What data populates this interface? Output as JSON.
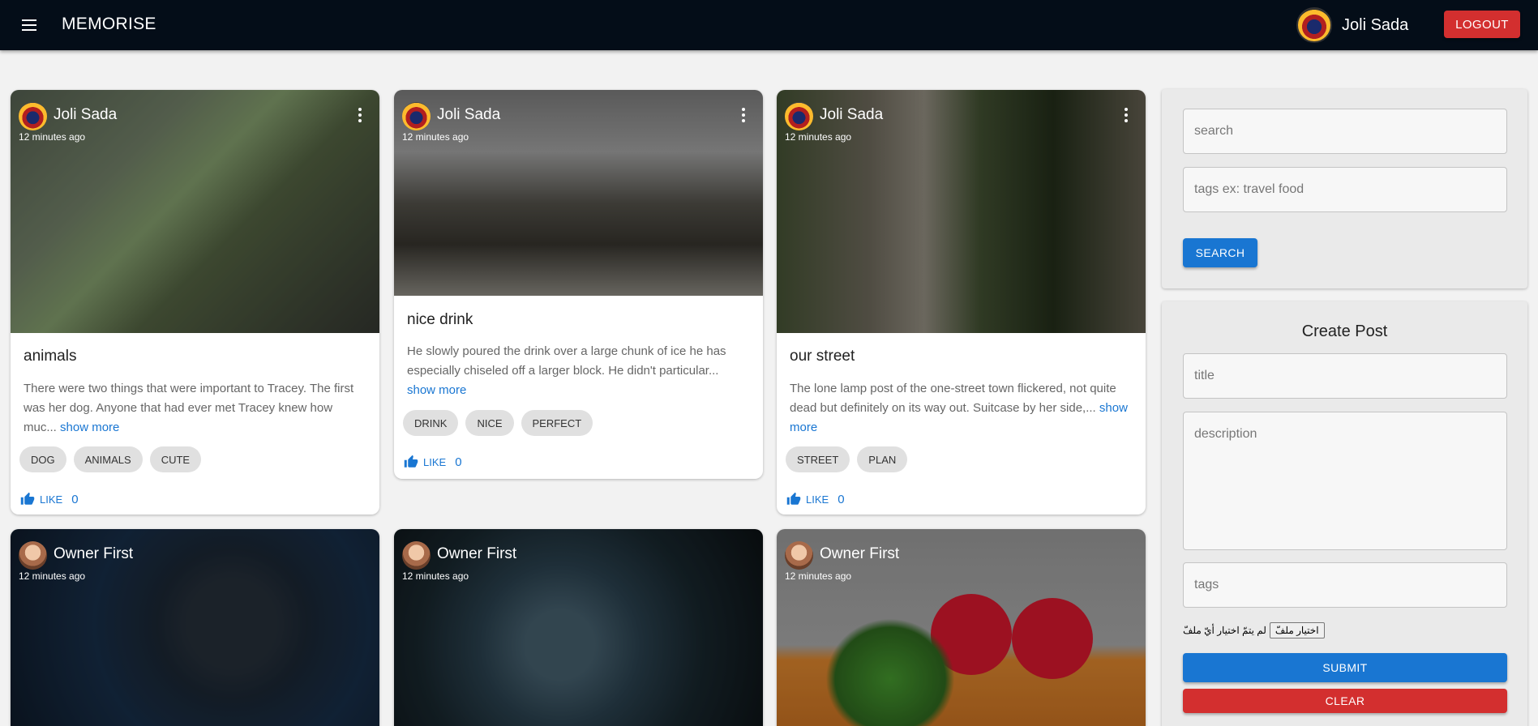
{
  "appbar": {
    "brand": "MEMORISE",
    "user_name": "Joli Sada",
    "logout_label": "LOGOUT"
  },
  "posts": [
    {
      "author": "Joli Sada",
      "time": "12 minutes ago",
      "title": "animals",
      "description": "There were two things that were important to Tracey. The first was her dog. Anyone that had ever met Tracey knew how muc...",
      "show_more": "show more",
      "tags": [
        "DOG",
        "ANIMALS",
        "CUTE"
      ],
      "like_label": "LIKE",
      "like_count": "0"
    },
    {
      "author": "Joli Sada",
      "time": "12 minutes ago",
      "title": "nice drink",
      "description": "He slowly poured the drink over a large chunk of ice he has especially chiseled off a larger block. He didn't particular...",
      "show_more": "show more",
      "tags": [
        "DRINK",
        "NICE",
        "PERFECT"
      ],
      "like_label": "LIKE",
      "like_count": "0"
    },
    {
      "author": "Joli Sada",
      "time": "12 minutes ago",
      "title": "our street",
      "description": "The lone lamp post of the one-street town flickered, not quite dead but definitely on its way out. Suitcase by her side,...",
      "show_more": "show more",
      "tags": [
        "STREET",
        "PLAN"
      ],
      "like_label": "LIKE",
      "like_count": "0"
    },
    {
      "author": "Owner First",
      "time": "12 minutes ago"
    },
    {
      "author": "Owner First",
      "time": "12 minutes ago"
    },
    {
      "author": "Owner First",
      "time": "12 minutes ago"
    }
  ],
  "search_panel": {
    "search_placeholder": "search",
    "tags_placeholder": "tags ex: travel food",
    "search_button": "SEARCH"
  },
  "create_panel": {
    "title": "Create Post",
    "title_placeholder": "title",
    "description_placeholder": "description",
    "tags_placeholder": "tags",
    "file_button": "اختيار ملفّ",
    "file_status": "لم يتمّ اختيار أيّ ملفّ",
    "submit_button": "SUBMIT",
    "clear_button": "CLEAR"
  },
  "colors": {
    "appbar": "#040d18",
    "primary": "#1976d2",
    "danger": "#d32f2f"
  }
}
